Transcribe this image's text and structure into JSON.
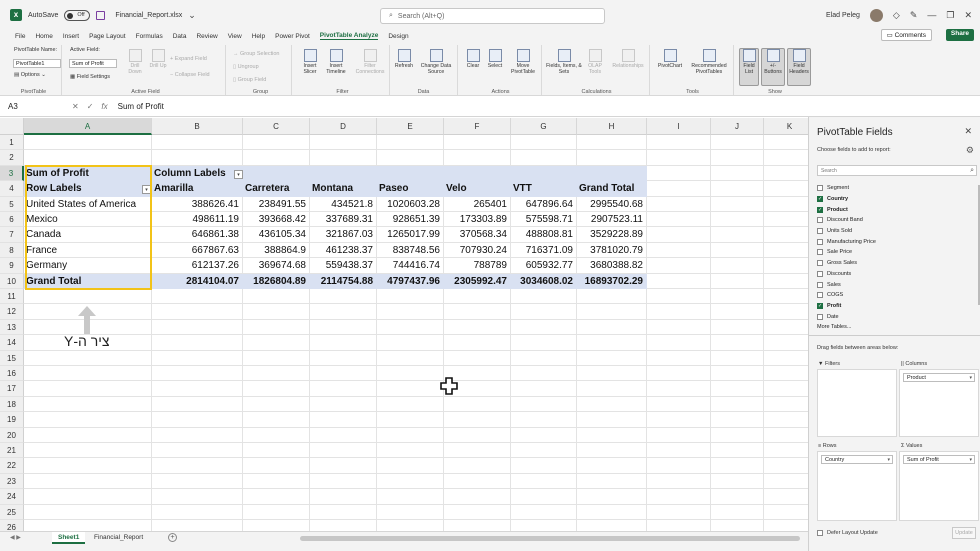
{
  "titlebar": {
    "autosave_label": "AutoSave",
    "autosave_state": "Off",
    "filename": "Financial_Report.xlsx",
    "search_placeholder": "Search (Alt+Q)",
    "user_name": "Elad Peleg"
  },
  "menu": {
    "tabs": [
      "File",
      "Home",
      "Insert",
      "Page Layout",
      "Formulas",
      "Data",
      "Review",
      "View",
      "Help",
      "Power Pivot",
      "PivotTable Analyze",
      "Design"
    ],
    "active": "PivotTable Analyze",
    "comments": "Comments",
    "share": "Share"
  },
  "ribbon": {
    "pivottable_name_label": "PivotTable Name:",
    "pivottable_name": "PivotTable1",
    "options": "Options",
    "group_pivottable": "PivotTable",
    "active_field_label": "Active Field:",
    "active_field": "Sum of Profit",
    "field_settings": "Field Settings",
    "drill_down": "Drill Down",
    "drill_up": "Drill Up",
    "expand_field": "Expand Field",
    "collapse_field": "Collapse Field",
    "group_active_field": "Active Field",
    "group_selection": "Group Selection",
    "ungroup": "Ungroup",
    "group_field": "Group Field",
    "group_group": "Group",
    "insert_slicer": "Insert Slicer",
    "insert_timeline": "Insert Timeline",
    "filter_connections": "Filter Connections",
    "group_filter": "Filter",
    "refresh": "Refresh",
    "change_data_source": "Change Data Source",
    "group_data": "Data",
    "clear": "Clear",
    "select": "Select",
    "move_pivottable": "Move PivotTable",
    "group_actions": "Actions",
    "fields_items_sets": "Fields, Items, & Sets",
    "olap_tools": "OLAP Tools",
    "relationships": "Relationships",
    "group_calculations": "Calculations",
    "pivotchart": "PivotChart",
    "recommended_pivottables": "Recommended PivotTables",
    "group_tools": "Tools",
    "field_list": "Field List",
    "plus_minus_buttons": "+/- Buttons",
    "field_headers": "Field Headers",
    "group_show": "Show"
  },
  "formula_bar": {
    "name_box": "A3",
    "formula": "Sum of Profit"
  },
  "grid": {
    "columns": [
      "A",
      "B",
      "C",
      "D",
      "E",
      "F",
      "G",
      "H",
      "I",
      "J",
      "K"
    ],
    "selected_column": "A",
    "rows": [
      "1",
      "2",
      "3",
      "4",
      "5",
      "6",
      "7",
      "8",
      "9",
      "10",
      "11",
      "12",
      "13",
      "14",
      "15",
      "16",
      "17",
      "18",
      "19",
      "20",
      "21",
      "22",
      "23",
      "24",
      "25",
      "26"
    ],
    "selected_row": "3"
  },
  "pivot": {
    "value_header": "Sum of Profit",
    "column_labels": "Column Labels",
    "row_labels": "Row Labels",
    "products": [
      "Amarilla",
      "Carretera",
      "Montana",
      "Paseo",
      "Velo",
      "VTT",
      "Grand Total"
    ],
    "rows": [
      {
        "label": "United States of America",
        "values": [
          "388626.41",
          "238491.55",
          "434521.8",
          "1020603.28",
          "265401",
          "647896.64",
          "2995540.68"
        ]
      },
      {
        "label": "Mexico",
        "values": [
          "498611.19",
          "393668.42",
          "337689.31",
          "928651.39",
          "173303.89",
          "575598.71",
          "2907523.11"
        ]
      },
      {
        "label": "Canada",
        "values": [
          "646861.38",
          "436105.34",
          "321867.03",
          "1265017.99",
          "370568.34",
          "488808.81",
          "3529228.89"
        ]
      },
      {
        "label": "France",
        "values": [
          "667867.63",
          "388864.9",
          "461238.37",
          "838748.56",
          "707930.24",
          "716371.09",
          "3781020.79"
        ]
      },
      {
        "label": "Germany",
        "values": [
          "612137.26",
          "369674.68",
          "559438.37",
          "744416.74",
          "788789",
          "605932.77",
          "3680388.82"
        ]
      }
    ],
    "grand_total": {
      "label": "Grand Total",
      "values": [
        "2814104.07",
        "1826804.89",
        "2114754.88",
        "4797437.96",
        "2305992.47",
        "3034608.02",
        "16893702.29"
      ]
    }
  },
  "annotation": {
    "text": "ציר ה-Y"
  },
  "sheets": {
    "tabs": [
      "Sheet1",
      "Financial_Report"
    ],
    "active": "Sheet1"
  },
  "pane": {
    "title": "PivotTable Fields",
    "subtitle": "Choose fields to add to report:",
    "search_placeholder": "Search",
    "fields": [
      {
        "name": "Segment",
        "checked": false
      },
      {
        "name": "Country",
        "checked": true
      },
      {
        "name": "Product",
        "checked": true
      },
      {
        "name": "Discount Band",
        "checked": false
      },
      {
        "name": "Units Sold",
        "checked": false
      },
      {
        "name": "Manufacturing Price",
        "checked": false
      },
      {
        "name": "Sale Price",
        "checked": false
      },
      {
        "name": "Gross Sales",
        "checked": false
      },
      {
        "name": "Discounts",
        "checked": false
      },
      {
        "name": "Sales",
        "checked": false
      },
      {
        "name": "COGS",
        "checked": false
      },
      {
        "name": "Profit",
        "checked": true
      },
      {
        "name": "Date",
        "checked": false
      },
      {
        "name": "More Tables...",
        "checked": null
      }
    ],
    "drag_label": "Drag fields between areas below:",
    "filters_label": "Filters",
    "columns_label": "Columns",
    "columns_item": "Product",
    "rows_label": "Rows",
    "rows_item": "Country",
    "values_label": "Values",
    "values_item": "Sum of Profit",
    "defer_label": "Defer Layout Update",
    "update_label": "Update"
  },
  "colors": {
    "excel_green": "#1d6f42",
    "pivot_band": "#d9e1f2",
    "highlight": "#f2c318"
  }
}
